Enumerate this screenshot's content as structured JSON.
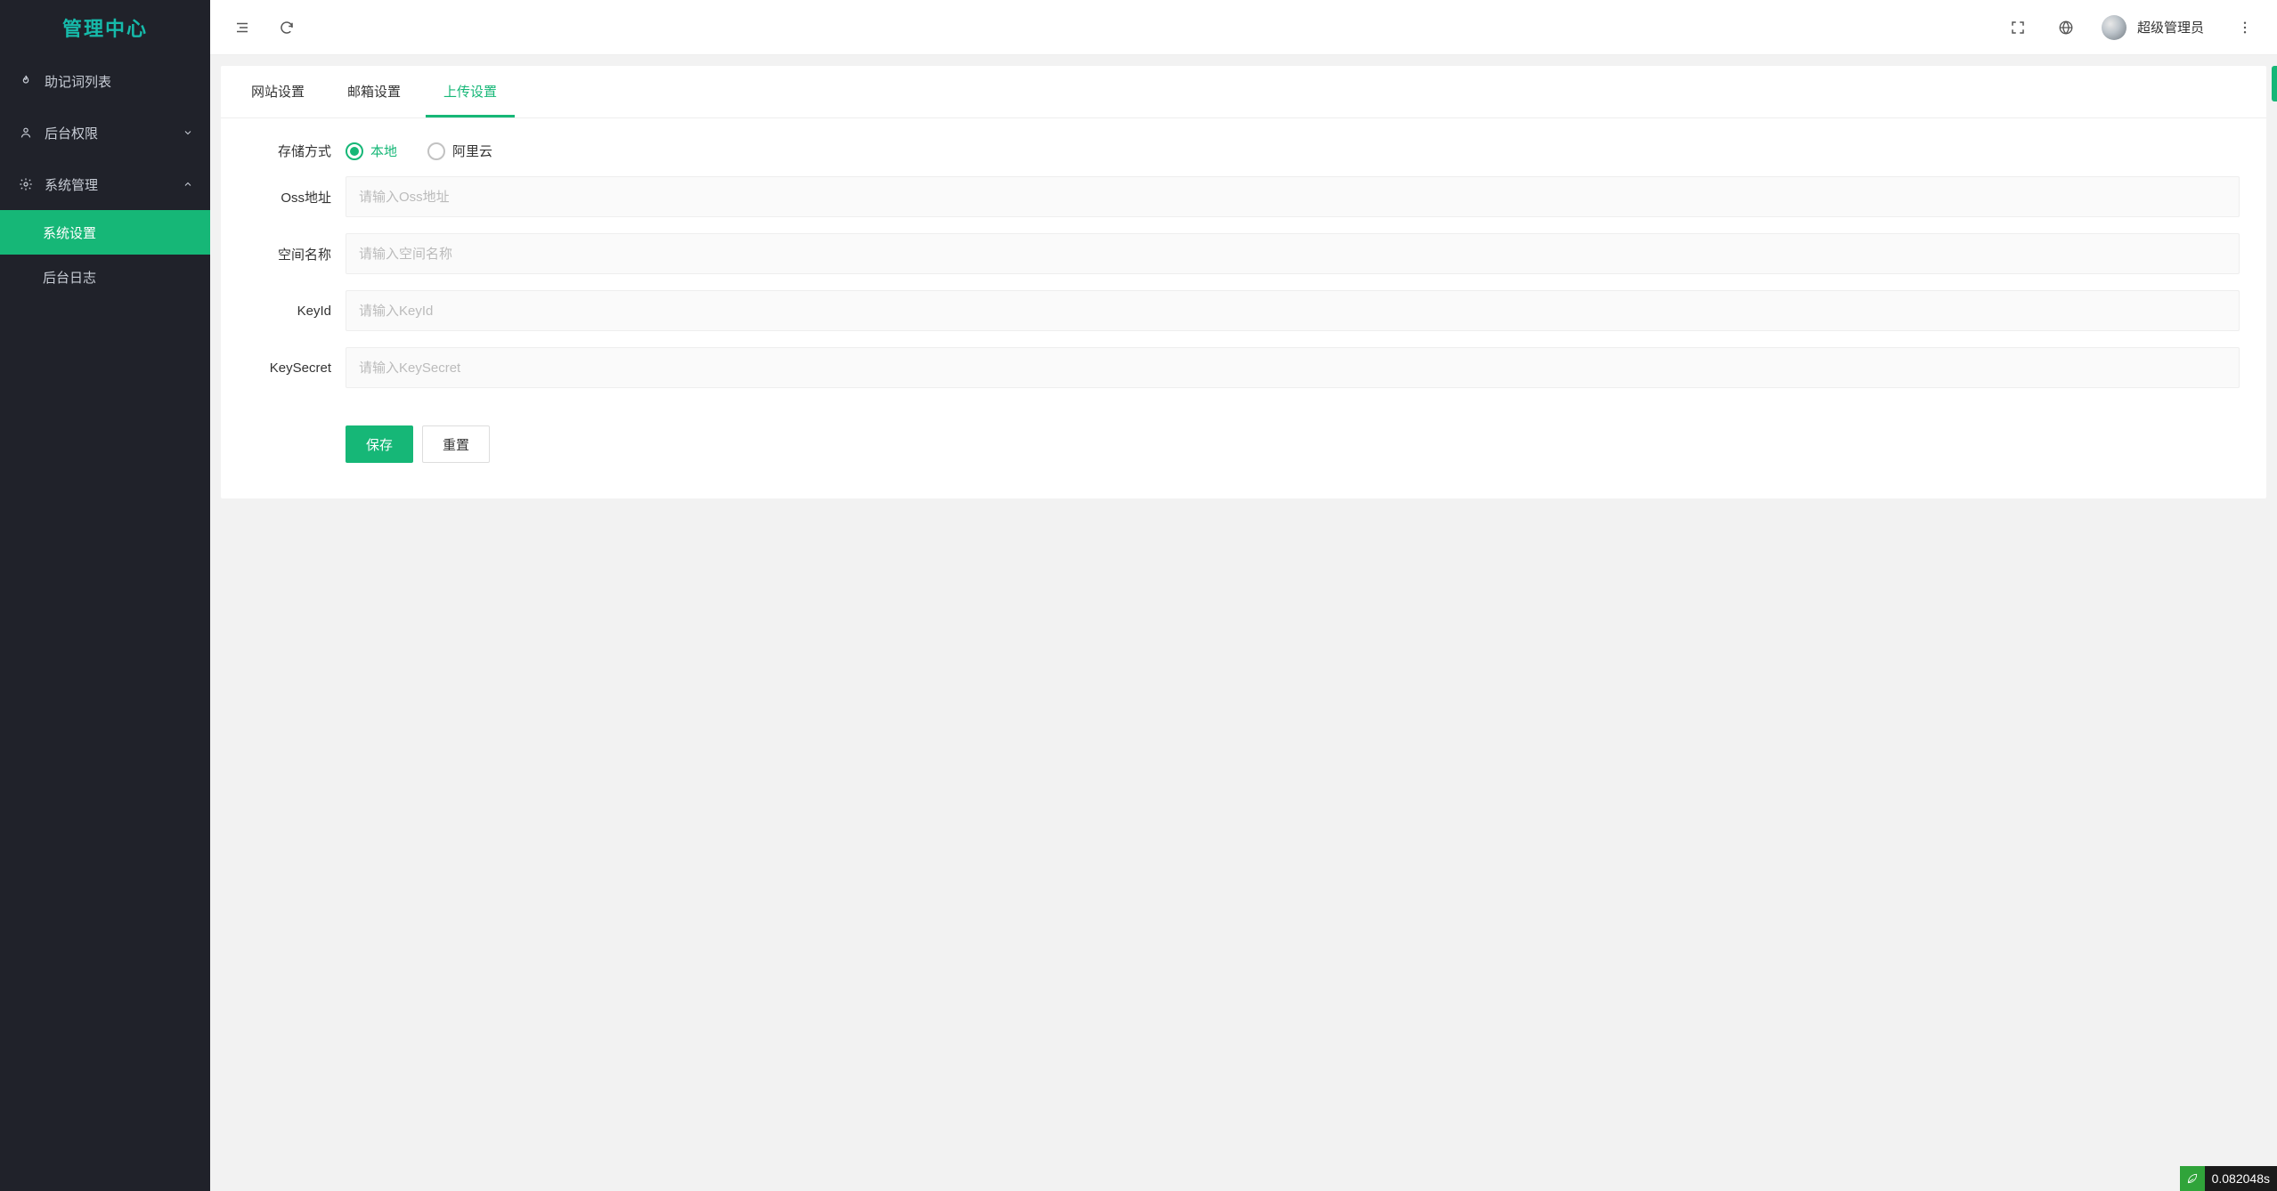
{
  "brand": {
    "title": "管理中心"
  },
  "sidebar": {
    "items": [
      {
        "label": "助记词列表"
      },
      {
        "label": "后台权限"
      },
      {
        "label": "系统管理"
      }
    ],
    "system_sub": [
      {
        "label": "系统设置"
      },
      {
        "label": "后台日志"
      }
    ]
  },
  "header": {
    "username": "超级管理员"
  },
  "tabs": [
    {
      "label": "网站设置"
    },
    {
      "label": "邮箱设置"
    },
    {
      "label": "上传设置"
    }
  ],
  "form": {
    "storage_label": "存储方式",
    "storage_options": {
      "local": "本地",
      "aliyun": "阿里云"
    },
    "oss_url": {
      "label": "Oss地址",
      "placeholder": "请输入Oss地址",
      "value": ""
    },
    "bucket": {
      "label": "空间名称",
      "placeholder": "请输入空间名称",
      "value": ""
    },
    "key_id": {
      "label": "KeyId",
      "placeholder": "请输入KeyId",
      "value": ""
    },
    "key_secret": {
      "label": "KeySecret",
      "placeholder": "请输入KeySecret",
      "value": ""
    },
    "buttons": {
      "save": "保存",
      "reset": "重置"
    }
  },
  "perf": {
    "time": "0.082048s"
  }
}
